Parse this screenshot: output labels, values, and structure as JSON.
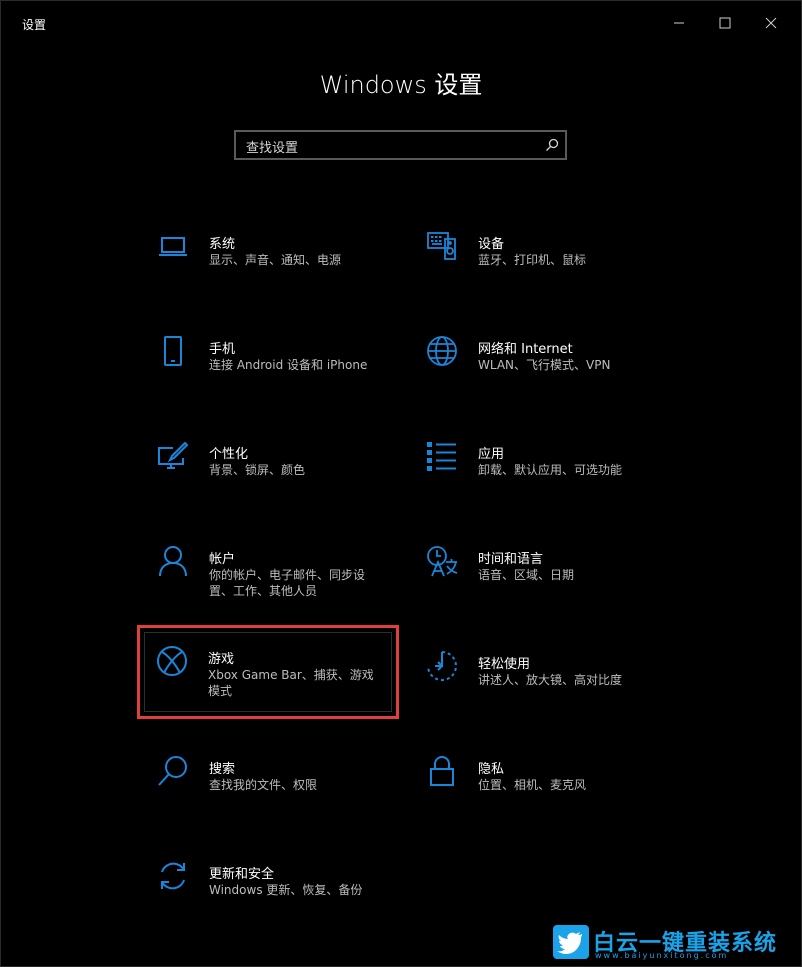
{
  "window": {
    "title": "设置"
  },
  "heading": "Windows 设置",
  "search": {
    "placeholder": "查找设置"
  },
  "tiles": [
    {
      "name": "系统",
      "desc": "显示、声音、通知、电源",
      "icon": "laptop-icon"
    },
    {
      "name": "设备",
      "desc": "蓝牙、打印机、鼠标",
      "icon": "devices-icon"
    },
    {
      "name": "手机",
      "desc": "连接 Android 设备和 iPhone",
      "icon": "phone-icon"
    },
    {
      "name": "网络和 Internet",
      "desc": "WLAN、飞行模式、VPN",
      "icon": "globe-icon"
    },
    {
      "name": "个性化",
      "desc": "背景、锁屏、颜色",
      "icon": "personalization-icon"
    },
    {
      "name": "应用",
      "desc": "卸载、默认应用、可选功能",
      "icon": "apps-list-icon"
    },
    {
      "name": "帐户",
      "desc": "你的帐户、电子邮件、同步设置、工作、其他人员",
      "icon": "person-icon"
    },
    {
      "name": "时间和语言",
      "desc": "语音、区域、日期",
      "icon": "time-language-icon"
    },
    {
      "name": "游戏",
      "desc": "Xbox Game Bar、捕获、游戏模式",
      "icon": "xbox-icon"
    },
    {
      "name": "轻松使用",
      "desc": "讲述人、放大镜、高对比度",
      "icon": "ease-of-access-icon"
    },
    {
      "name": "搜索",
      "desc": "查找我的文件、权限",
      "icon": "search-icon"
    },
    {
      "name": "隐私",
      "desc": "位置、相机、麦克风",
      "icon": "lock-icon"
    },
    {
      "name": "更新和安全",
      "desc": "Windows 更新、恢复、备份",
      "icon": "sync-icon"
    }
  ],
  "watermark": {
    "text": "白云一键重装系统",
    "sub": "www.baiyunxitong.com"
  },
  "colors": {
    "accent": "#1a86d9",
    "highlight": "#e0403c",
    "background": "#000000"
  }
}
